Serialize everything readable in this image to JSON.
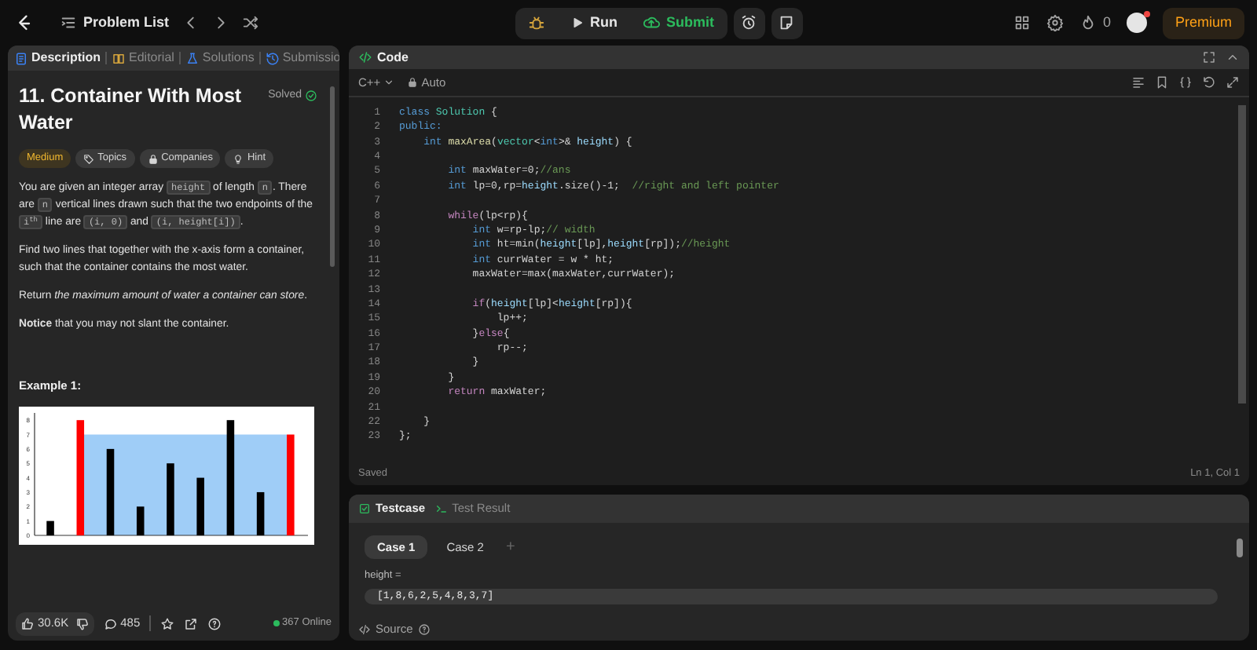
{
  "topbar": {
    "problem_list": "Problem List",
    "run": "Run",
    "submit": "Submit",
    "streak": "0",
    "premium": "Premium",
    "notification_dot": true
  },
  "description_panel": {
    "tabs": [
      {
        "label": "Description",
        "selected": true
      },
      {
        "label": "Editorial",
        "selected": false
      },
      {
        "label": "Solutions",
        "selected": false
      },
      {
        "label": "Submissio",
        "selected": false
      }
    ],
    "title": "11. Container With Most Water",
    "status": "Solved",
    "tags": [
      {
        "kind": "difficulty",
        "label": "Medium"
      },
      {
        "kind": "topics",
        "label": "Topics"
      },
      {
        "kind": "companies",
        "label": "Companies"
      },
      {
        "kind": "hint",
        "label": "Hint"
      }
    ],
    "paragraphs": [
      [
        {
          "kind": "text",
          "text": "You are given an integer array "
        },
        {
          "kind": "code",
          "text": "height"
        },
        {
          "kind": "text",
          "text": " of length "
        },
        {
          "kind": "code",
          "text": "n"
        },
        {
          "kind": "text",
          "text": ". There are "
        },
        {
          "kind": "code",
          "text": "n"
        },
        {
          "kind": "text",
          "text": " vertical lines drawn such that the two endpoints of the "
        },
        {
          "kind": "code",
          "text": "i$^{th}$"
        },
        {
          "kind": "text",
          "text": " line are "
        },
        {
          "kind": "code",
          "text": "(i, 0)"
        },
        {
          "kind": "text",
          "text": " and "
        },
        {
          "kind": "code",
          "text": "(i, height[i])"
        },
        {
          "kind": "text",
          "text": "."
        }
      ],
      [
        {
          "kind": "text",
          "text": "Find two lines that together with the x-axis form a container, such that the container contains the most water."
        }
      ],
      [
        {
          "kind": "text",
          "text": "Return *the maximum amount of water a container can store*."
        }
      ],
      [
        {
          "kind": "text",
          "text": "**Notice** that you may not slant the container."
        }
      ]
    ],
    "example_heading": "Example 1:",
    "example_chart": {
      "chart_data": {
        "type": "bar",
        "ylim": [
          0,
          8.5
        ],
        "yticks": [
          0,
          1,
          2,
          3,
          4,
          5,
          6,
          7,
          8
        ],
        "series": [
          {
            "color": "#000000",
            "values": [
              1,
              null,
              6,
              2,
              5,
              4,
              8,
              3,
              null
            ]
          },
          {
            "color": "#ff0000",
            "values": [
              null,
              8,
              null,
              null,
              null,
              null,
              null,
              null,
              7
            ]
          }
        ]
      }
    },
    "footer": {
      "likes": "30.6K",
      "comments": "485",
      "online": "367 Online"
    }
  },
  "code_panel": {
    "title": "Code",
    "language": "C++",
    "mode": "Auto",
    "lines": [
      {
        "number": "1",
        "tokens": [
          {
            "kind": "keyword",
            "text": "class "
          },
          {
            "kind": "type",
            "text": "Solution"
          },
          {
            "kind": "plain",
            "text": " {"
          }
        ]
      },
      {
        "number": "2",
        "tokens": [
          {
            "kind": "keyword",
            "text": "public:"
          }
        ]
      },
      {
        "number": "3",
        "tokens": [
          {
            "kind": "keyword",
            "text": "    int "
          },
          {
            "kind": "function",
            "text": "maxArea"
          },
          {
            "kind": "plain",
            "text": "("
          },
          {
            "kind": "type",
            "text": "vector"
          },
          {
            "kind": "plain",
            "text": "<"
          },
          {
            "kind": "keyword",
            "text": "int"
          },
          {
            "kind": "plain",
            "text": ">& "
          },
          {
            "kind": "variable",
            "text": "height"
          },
          {
            "kind": "plain",
            "text": ") {"
          }
        ]
      },
      {
        "number": "4"
      },
      {
        "number": "5",
        "tokens": [
          {
            "kind": "keyword",
            "text": "        int"
          },
          {
            "kind": "plain",
            "text": " maxWater=0;"
          },
          {
            "kind": "comment",
            "text": "//ans"
          }
        ]
      },
      {
        "number": "6",
        "tokens": [
          {
            "kind": "keyword",
            "text": "        int"
          },
          {
            "kind": "plain",
            "text": " lp=0,rp="
          },
          {
            "kind": "variable",
            "text": "height"
          },
          {
            "kind": "plain",
            "text": ".size()-1;  "
          },
          {
            "kind": "comment",
            "text": "//right and left pointer"
          }
        ]
      },
      {
        "number": "7"
      },
      {
        "number": "8",
        "tokens": [
          {
            "kind": "control",
            "text": "        while"
          },
          {
            "kind": "plain",
            "text": "(lp<rp){"
          }
        ]
      },
      {
        "number": "9",
        "tokens": [
          {
            "kind": "keyword",
            "text": "            int"
          },
          {
            "kind": "plain",
            "text": " w=rp-lp;"
          },
          {
            "kind": "comment",
            "text": "// width"
          }
        ]
      },
      {
        "number": "10",
        "tokens": [
          {
            "kind": "keyword",
            "text": "            int"
          },
          {
            "kind": "plain",
            "text": " ht=min("
          },
          {
            "kind": "variable",
            "text": "height"
          },
          {
            "kind": "plain",
            "text": "[lp],"
          },
          {
            "kind": "variable",
            "text": "height"
          },
          {
            "kind": "plain",
            "text": "[rp]);"
          },
          {
            "kind": "comment",
            "text": "//height"
          }
        ]
      },
      {
        "number": "11",
        "tokens": [
          {
            "kind": "keyword",
            "text": "            int"
          },
          {
            "kind": "plain",
            "text": " currWater = w * ht;"
          }
        ]
      },
      {
        "number": "12",
        "tokens": [
          {
            "kind": "plain",
            "text": "            maxWater=max(maxWater,currWater);"
          }
        ]
      },
      {
        "number": "13"
      },
      {
        "number": "14",
        "tokens": [
          {
            "kind": "control",
            "text": "            if"
          },
          {
            "kind": "plain",
            "text": "("
          },
          {
            "kind": "variable",
            "text": "height"
          },
          {
            "kind": "plain",
            "text": "[lp]<"
          },
          {
            "kind": "variable",
            "text": "height"
          },
          {
            "kind": "plain",
            "text": "[rp]){"
          }
        ]
      },
      {
        "number": "15",
        "tokens": [
          {
            "kind": "plain",
            "text": "                lp++;"
          }
        ]
      },
      {
        "number": "16",
        "tokens": [
          {
            "kind": "plain",
            "text": "            }"
          },
          {
            "kind": "control",
            "text": "else"
          },
          {
            "kind": "plain",
            "text": "{"
          }
        ]
      },
      {
        "number": "17",
        "tokens": [
          {
            "kind": "plain",
            "text": "                rp--;"
          }
        ]
      },
      {
        "number": "18",
        "tokens": [
          {
            "kind": "plain",
            "text": "            }"
          }
        ]
      },
      {
        "number": "19",
        "tokens": [
          {
            "kind": "plain",
            "text": "        }"
          }
        ]
      },
      {
        "number": "20",
        "tokens": [
          {
            "kind": "control",
            "text": "        return"
          },
          {
            "kind": "plain",
            "text": " maxWater;"
          }
        ]
      },
      {
        "number": "21"
      },
      {
        "number": "22",
        "tokens": [
          {
            "kind": "plain",
            "text": "    }"
          }
        ]
      },
      {
        "number": "23",
        "tokens": [
          {
            "kind": "plain",
            "text": "};"
          }
        ]
      }
    ],
    "saved": "Saved",
    "cursor": "Ln 1, Col 1"
  },
  "testcase_panel": {
    "tabs": [
      {
        "label": "Testcase",
        "selected": true
      },
      {
        "label": "Test Result",
        "selected": false
      }
    ],
    "cases": [
      {
        "label": "Case 1",
        "selected": true
      },
      {
        "label": "Case 2",
        "selected": false
      }
    ],
    "add": "+",
    "input_label": "height =",
    "input_value": "[1,8,6,2,5,4,8,3,7]",
    "source": "Source"
  }
}
